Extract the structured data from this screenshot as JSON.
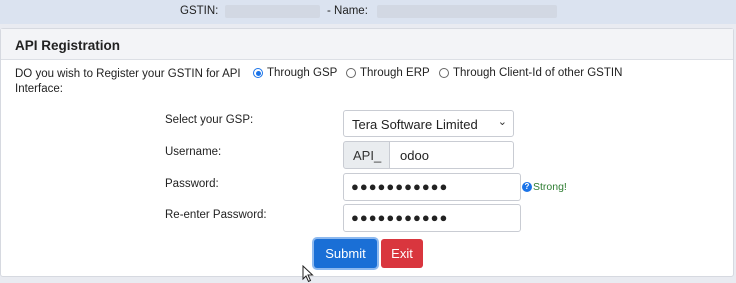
{
  "topbar": {
    "gstin_label": "GSTIN:",
    "name_label": "- Name:"
  },
  "panel": {
    "title": "API Registration"
  },
  "question": "DO you wish to Register your GSTIN for API Interface:",
  "options": [
    {
      "label": "Through GSP",
      "checked": true
    },
    {
      "label": "Through ERP",
      "checked": false
    },
    {
      "label": "Through Client-Id of other GSTIN",
      "checked": false
    }
  ],
  "form": {
    "gsp_label": "Select your GSP:",
    "gsp_value": "Tera Software Limited",
    "username_label": "Username:",
    "username_prefix": "API_",
    "username_value": "odoo",
    "password_label": "Password:",
    "password_value": "●●●●●●●●●●●",
    "strength": "Strong!",
    "repassword_label": "Re-enter Password:",
    "repassword_value": "●●●●●●●●●●●"
  },
  "buttons": {
    "submit": "Submit",
    "exit": "Exit"
  },
  "colors": {
    "primary": "#1a6fd6",
    "danger": "#d9363e",
    "success": "#2e7d32"
  },
  "icons": {
    "help": "question-circle-icon",
    "select": "chevron-down-icon",
    "cursor": "mouse-pointer-icon"
  }
}
